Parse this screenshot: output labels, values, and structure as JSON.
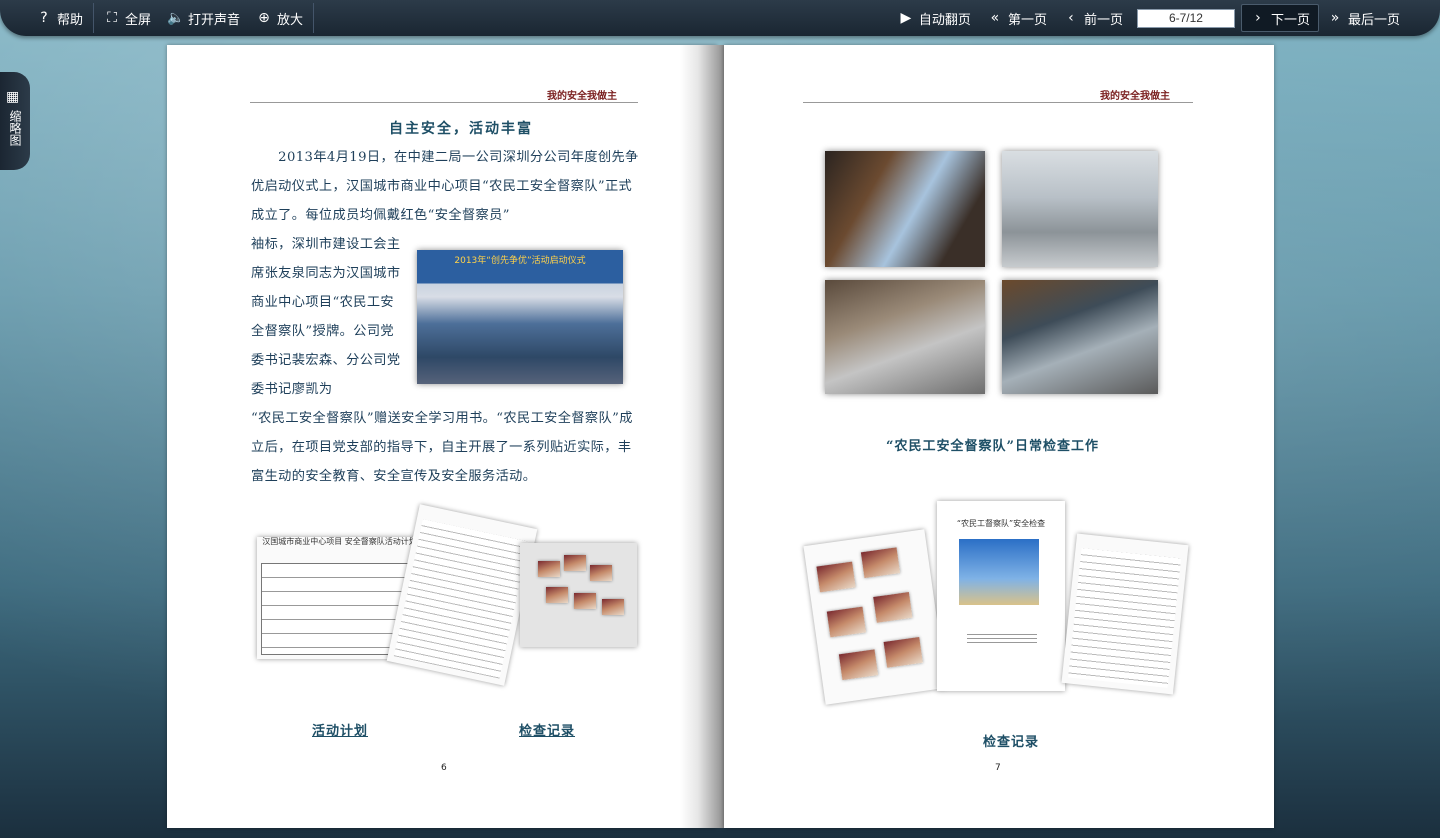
{
  "toolbar": {
    "help": "帮助",
    "fullscreen": "全屏",
    "sound": "打开声音",
    "zoom": "放大",
    "auto_flip": "自动翻页",
    "first_page": "第一页",
    "prev_page": "前一页",
    "page_indicator": "6-7/12",
    "next_page": "下一页",
    "last_page": "最后一页"
  },
  "side_tab": {
    "label": "缩略图"
  },
  "left_page": {
    "running_head": "我的安全我做主",
    "title": "自主安全，活动丰富",
    "para1": "　　2013年4月19日，在中建二局一公司深圳分公司年度创先争优启动仪式上，汉国城市商业中心项目“农民工安全督察队”正式成立了。每位成员均佩戴红色“安全督察员”",
    "para_left_col": "袖标，深圳市建设工会主席张友泉同志为汉国城市商业中心项目“农民工安全督察队”授牌。公司党委书记裴宏森、分公司党委书记廖凯为",
    "para2": "“农民工安全督察队”赠送安全学习用书。“农民工安全督察队”成立后，在项目党支部的指导下，自主开展了一系列贴近实际，丰富生动的安全教育、安全宣传及安全服务活动。",
    "photo_banner": "2013年“创先争优”活动启动仪式",
    "doc_title": "汉国城市商业中心项目 安全督察队活动计划",
    "caption_plan": "活动计划",
    "caption_records": "检查记录",
    "page_number": "6"
  },
  "right_page": {
    "running_head": "我的安全我做主",
    "photo_caption": "“农民工安全督察队”日常检查工作",
    "doc_title": "“农民工督察队”安全检查",
    "caption_records": "检查记录",
    "page_number": "7"
  }
}
